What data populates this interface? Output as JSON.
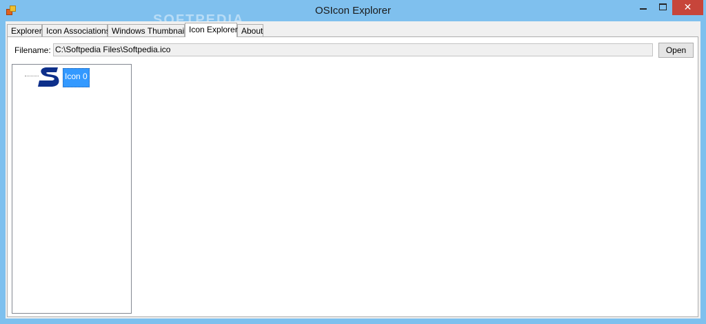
{
  "window": {
    "title": "OSIcon Explorer",
    "watermark": "SOFTPEDIA",
    "close_glyph": "✕"
  },
  "tabs": [
    {
      "label": "Explorer"
    },
    {
      "label": "Icon Associations"
    },
    {
      "label": "Windows Thumbnails"
    },
    {
      "label": "Icon Explorer",
      "active": true
    },
    {
      "label": "About"
    }
  ],
  "form": {
    "filename_label": "Filename:",
    "filename_value": "C:\\Softpedia Files\\Softpedia.ico",
    "open_label": "Open"
  },
  "tree": {
    "items": [
      {
        "label": "Icon 0",
        "icon": "softpedia-s-icon",
        "selected": true
      }
    ]
  },
  "colors": {
    "titlebar": "#7fc0ee",
    "close": "#c7453a",
    "selection": "#3399ff",
    "softpedia_blue": "#0d2f8a"
  }
}
